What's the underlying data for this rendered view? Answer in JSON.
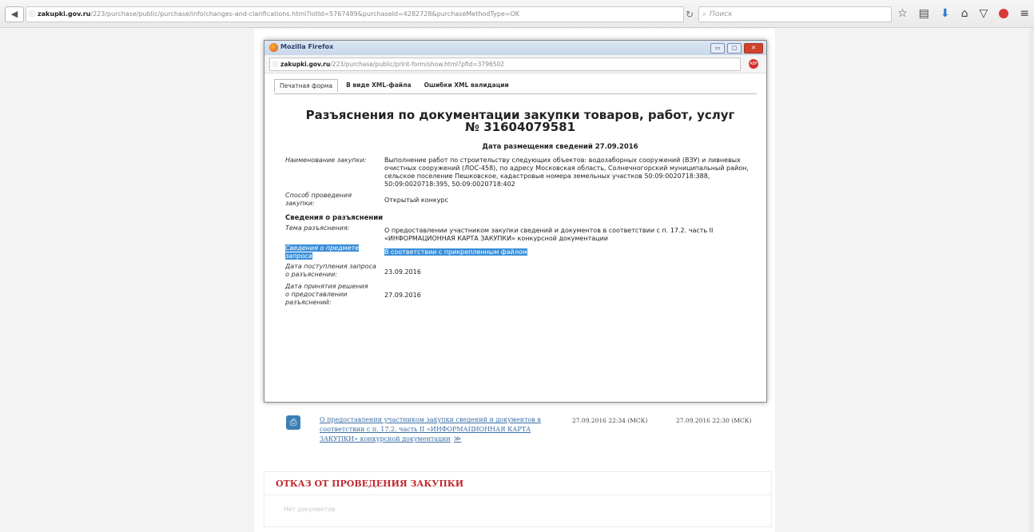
{
  "browser": {
    "url_host": "zakupki.gov.ru",
    "url_path": "/223/purchase/public/purchase/info/changes-and-clarifications.html?lotId=5767489&purchaseId=4282728&purchaseMethodType=OK",
    "search_placeholder": "Поиск"
  },
  "popup": {
    "window_title": "Mozilla Firefox",
    "url_host": "zakupki.gov.ru",
    "url_path": "/223/purchase/public/print-form/show.html?pfid=3796502",
    "tabs": [
      "Печатная форма",
      "В виде XML-файла",
      "Ошибки XML валидации"
    ],
    "doc_title": "Разъяснения по документации закупки товаров, работ, услуг № 31604079581",
    "publish_date": "Дата размещения сведений 27.09.2016",
    "fields": {
      "purchase_name_label": "Наименование закупки:",
      "purchase_name_value": "Выполнение работ по строительству следующих объектов: водозаборных сооружений (ВЗУ) и ливневых очистных сооружений (ЛОС-458), по адресу Московская область, Солнечногорский муниципальный район, сельское поселение Пешковское, кадастровые номера земельных участков 50:09:0020718:388, 50:09:0020718:395, 50:09:0020718:402",
      "method_label": "Способ проведения закупки:",
      "method_value": "Открытый конкурс",
      "section_title": "Сведения о разъяснении",
      "topic_label": "Тема разъяснения:",
      "topic_value": "О предоставлении участником закупки сведений и документов в соответствии с п. 17.2. часть II «ИНФОРМАЦИОННАЯ КАРТА ЗАКУПКИ» конкурсной документации",
      "subject_label": "Сведения о предмете запроса",
      "subject_value": "В соответствии с прикрепленным файлом",
      "request_date_label": "Дата поступления запроса о разъяснении:",
      "request_date_value": "23.09.2016",
      "decision_date_label": "Дата принятия решения о предоставлении разъяснений:",
      "decision_date_value": "27.09.2016"
    }
  },
  "background": {
    "doc_link": "О предоставлении участником закупки сведений и документов в соответствии с п. 17.2. часть II «ИНФОРМАЦИОННАЯ КАРТА ЗАКУПКИ» конкурсной документации",
    "date1": "27.09.2016 22:34 (МСК)",
    "date2": "27.09.2016 22:30 (МСК)",
    "refusal_title": "ОТКАЗ ОТ ПРОВЕДЕНИЯ ЗАКУПКИ",
    "refusal_empty": "Нет документов"
  }
}
